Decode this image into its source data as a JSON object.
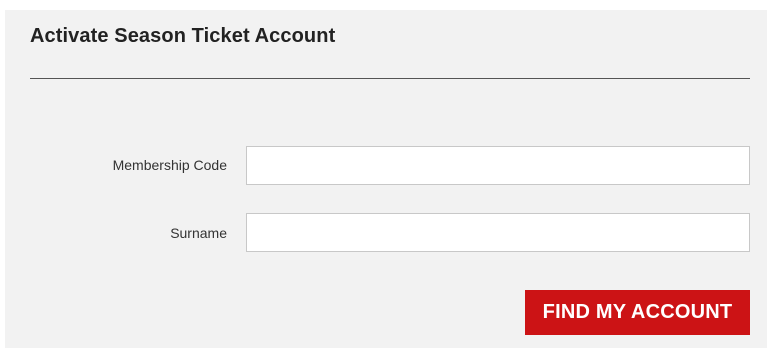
{
  "form": {
    "title": "Activate Season Ticket Account",
    "fields": {
      "membership_code": {
        "label": "Membership Code",
        "value": "",
        "placeholder": ""
      },
      "surname": {
        "label": "Surname",
        "value": "",
        "placeholder": ""
      }
    },
    "submit_label": "FIND MY ACCOUNT"
  },
  "colors": {
    "panel_background": "#f2f2f2",
    "button_background": "#cc1315",
    "button_text": "#ffffff",
    "title_text": "#222222"
  }
}
